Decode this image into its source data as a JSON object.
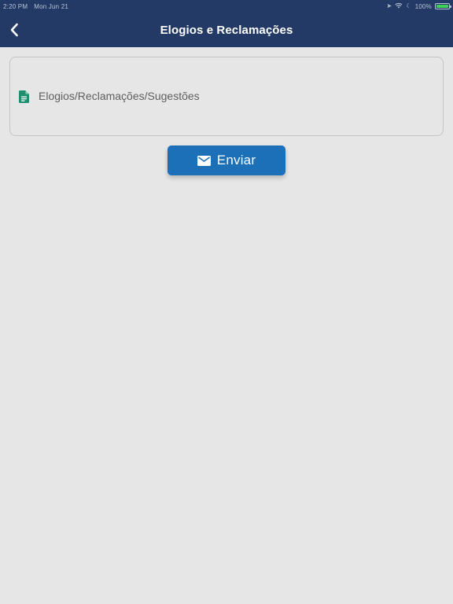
{
  "status_bar": {
    "time": "2:20 PM",
    "date": "Mon Jun 21",
    "battery_text": "100%",
    "icons": [
      "location-icon",
      "wifi-icon",
      "moon-icon",
      "battery-icon"
    ]
  },
  "nav": {
    "title": "Elogios e Reclamações",
    "back_icon": "chevron-left-icon"
  },
  "message_field": {
    "placeholder": "Elogios/Reclamações/Sugestões",
    "icon": "document-icon",
    "icon_color": "#1e8f6e"
  },
  "send_button": {
    "label": "Enviar",
    "icon": "mail-icon"
  },
  "colors": {
    "header": "#233a66",
    "background": "#e6e6e6",
    "button": "#1b70b7",
    "field_border": "#c4c4c4"
  }
}
